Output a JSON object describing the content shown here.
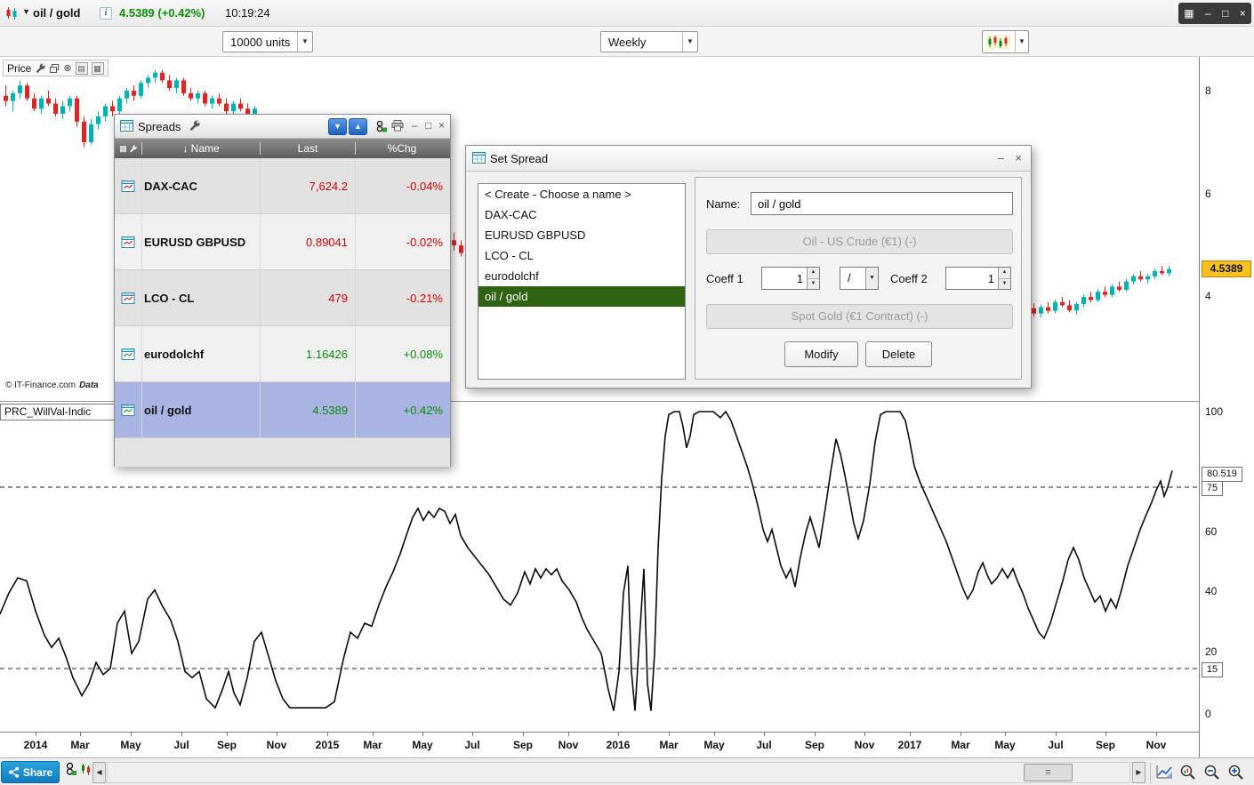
{
  "titlebar": {
    "symbol": "oil / gold",
    "quote": "4.5389 (+0.42%)",
    "time": "10:19:24",
    "info": "i"
  },
  "toolbar": {
    "units_value": "10000 units",
    "period_value": "Weekly"
  },
  "price_panel": {
    "label": "Price",
    "copyright": "© IT-Finance.com",
    "copyright_suffix": "Data"
  },
  "indicator_label": "PRC_WillVal-Indic",
  "axes": {
    "price_ticks": [
      "8",
      "6",
      "4"
    ],
    "price_badge": "4.5389",
    "ind_ticks": [
      "100",
      "60",
      "40",
      "20",
      "0"
    ],
    "ind_badge": "80.519",
    "ind_level_hi": "75",
    "ind_level_lo": "15"
  },
  "spreads_window": {
    "title": "Spreads",
    "header": {
      "name": "Name",
      "last": "Last",
      "chg": "%Chg"
    },
    "rows": [
      {
        "name": "DAX-CAC",
        "last": "7,624.2",
        "chg": "-0.04%",
        "dir": "down",
        "selected": false
      },
      {
        "name": "EURUSD GBPUSD",
        "last": "0.89041",
        "chg": "-0.02%",
        "dir": "down",
        "selected": false
      },
      {
        "name": "LCO - CL",
        "last": "479",
        "chg": "-0.21%",
        "dir": "down",
        "selected": false
      },
      {
        "name": "eurodolchf",
        "last": "1.16426",
        "chg": "+0.08%",
        "dir": "up",
        "selected": false
      },
      {
        "name": "oil / gold",
        "last": "4.5389",
        "chg": "+0.42%",
        "dir": "up",
        "selected": true
      }
    ]
  },
  "set_spread": {
    "title": "Set Spread",
    "list": [
      "< Create - Choose a name >",
      "DAX-CAC",
      "EURUSD GBPUSD",
      "LCO - CL",
      "eurodolchf",
      "oil / gold"
    ],
    "selected_index": 5,
    "name_label": "Name:",
    "name_value": "oil / gold",
    "instrument1": "Oil - US Crude (€1) (-)",
    "coeff1_label": "Coeff 1",
    "coeff1_value": "1",
    "operator": "/",
    "coeff2_label": "Coeff 2",
    "coeff2_value": "1",
    "instrument2": "Spot Gold (€1 Contract) (-)",
    "modify_label": "Modify",
    "delete_label": "Delete"
  },
  "bottom_bar": {
    "share_label": "Share",
    "thumb_grip": "≡"
  },
  "colors": {
    "candle_up": "#00b3b3",
    "candle_down": "#dd2626",
    "positive": "#0a8a0a",
    "negative": "#d40000",
    "selected_row": "#a9b4e2",
    "selected_list_item": "#2e6311",
    "price_badge_bg": "#f7c11e",
    "accent_blue": "#1d64c0"
  },
  "chart_data": {
    "type": "candlestick+line",
    "period": "Weekly",
    "price_panel": {
      "yticks": [
        8,
        6,
        4
      ],
      "last": 4.5389,
      "candles": [
        [
          4,
          7.9,
          8.1,
          7.7,
          7.8
        ],
        [
          12,
          7.8,
          8.0,
          7.6,
          7.95
        ],
        [
          20,
          7.95,
          8.2,
          7.85,
          8.1
        ],
        [
          28,
          8.1,
          8.15,
          7.8,
          7.85
        ],
        [
          36,
          7.85,
          7.95,
          7.6,
          7.65
        ],
        [
          44,
          7.65,
          7.9,
          7.55,
          7.85
        ],
        [
          52,
          7.85,
          8.0,
          7.7,
          7.75
        ],
        [
          60,
          7.75,
          7.85,
          7.5,
          7.55
        ],
        [
          68,
          7.55,
          7.8,
          7.45,
          7.7
        ],
        [
          76,
          7.7,
          7.9,
          7.6,
          7.85
        ],
        [
          84,
          7.85,
          7.9,
          7.3,
          7.4
        ],
        [
          92,
          7.4,
          7.5,
          6.9,
          7.0
        ],
        [
          100,
          7.0,
          7.45,
          6.95,
          7.35
        ],
        [
          108,
          7.35,
          7.6,
          7.25,
          7.5
        ],
        [
          116,
          7.5,
          7.75,
          7.4,
          7.7
        ],
        [
          124,
          7.7,
          7.8,
          7.5,
          7.6
        ],
        [
          132,
          7.6,
          7.9,
          7.55,
          7.85
        ],
        [
          140,
          7.85,
          8.05,
          7.75,
          8.0
        ],
        [
          148,
          8.0,
          8.1,
          7.8,
          7.9
        ],
        [
          156,
          7.9,
          8.2,
          7.85,
          8.15
        ],
        [
          164,
          8.15,
          8.3,
          8.05,
          8.25
        ],
        [
          172,
          8.25,
          8.4,
          8.15,
          8.35
        ],
        [
          180,
          8.35,
          8.4,
          8.15,
          8.2
        ],
        [
          188,
          8.2,
          8.3,
          8.0,
          8.05
        ],
        [
          196,
          8.05,
          8.25,
          7.95,
          8.2
        ],
        [
          204,
          8.2,
          8.25,
          7.9,
          7.95
        ],
        [
          212,
          7.95,
          8.05,
          7.8,
          7.85
        ],
        [
          220,
          7.85,
          8.0,
          7.75,
          7.95
        ],
        [
          228,
          7.95,
          8.0,
          7.7,
          7.75
        ],
        [
          236,
          7.75,
          7.9,
          7.65,
          7.85
        ],
        [
          244,
          7.85,
          7.95,
          7.7,
          7.75
        ],
        [
          252,
          7.75,
          7.85,
          7.55,
          7.6
        ],
        [
          260,
          7.6,
          7.8,
          7.5,
          7.75
        ],
        [
          268,
          7.75,
          7.85,
          7.6,
          7.65
        ],
        [
          276,
          7.65,
          7.75,
          7.5,
          7.55
        ],
        [
          284,
          7.55,
          7.7,
          7.45,
          7.65
        ],
        [
          508,
          5.1,
          5.25,
          4.9,
          5.0
        ],
        [
          516,
          5.0,
          5.1,
          4.78,
          4.85
        ],
        [
          1152,
          3.85,
          3.95,
          3.72,
          3.78
        ],
        [
          1160,
          3.78,
          3.88,
          3.62,
          3.68
        ],
        [
          1168,
          3.68,
          3.85,
          3.6,
          3.8
        ],
        [
          1176,
          3.8,
          3.9,
          3.68,
          3.73
        ],
        [
          1184,
          3.73,
          3.95,
          3.68,
          3.9
        ],
        [
          1192,
          3.9,
          4.0,
          3.8,
          3.84
        ],
        [
          1200,
          3.84,
          3.94,
          3.7,
          3.74
        ],
        [
          1208,
          3.74,
          3.9,
          3.66,
          3.86
        ],
        [
          1216,
          3.86,
          4.05,
          3.8,
          4.0
        ],
        [
          1224,
          4.0,
          4.1,
          3.9,
          3.94
        ],
        [
          1232,
          3.94,
          4.15,
          3.9,
          4.1
        ],
        [
          1240,
          4.1,
          4.2,
          4.0,
          4.04
        ],
        [
          1248,
          4.04,
          4.25,
          4.0,
          4.2
        ],
        [
          1256,
          4.2,
          4.3,
          4.1,
          4.14
        ],
        [
          1264,
          4.14,
          4.35,
          4.1,
          4.3
        ],
        [
          1272,
          4.3,
          4.44,
          4.24,
          4.4
        ],
        [
          1280,
          4.4,
          4.5,
          4.3,
          4.34
        ],
        [
          1288,
          4.34,
          4.45,
          4.26,
          4.4
        ],
        [
          1296,
          4.4,
          4.55,
          4.34,
          4.5
        ],
        [
          1304,
          4.5,
          4.6,
          4.42,
          4.46
        ],
        [
          1312,
          4.46,
          4.6,
          4.4,
          4.54
        ]
      ]
    },
    "indicator": {
      "name": "PRC_WillVal-Indic",
      "yticks": [
        100,
        75,
        60,
        40,
        20,
        15,
        0
      ],
      "levels": [
        75,
        15
      ],
      "last": 80.519,
      "points": [
        [
          0,
          33
        ],
        [
          10,
          40
        ],
        [
          20,
          45
        ],
        [
          30,
          44
        ],
        [
          40,
          34
        ],
        [
          50,
          26
        ],
        [
          58,
          22
        ],
        [
          66,
          25
        ],
        [
          74,
          19
        ],
        [
          82,
          12
        ],
        [
          92,
          6
        ],
        [
          100,
          10
        ],
        [
          108,
          17
        ],
        [
          116,
          13
        ],
        [
          124,
          15
        ],
        [
          132,
          30
        ],
        [
          140,
          34
        ],
        [
          148,
          20
        ],
        [
          156,
          24
        ],
        [
          166,
          38
        ],
        [
          174,
          41
        ],
        [
          182,
          36
        ],
        [
          192,
          31
        ],
        [
          200,
          24
        ],
        [
          208,
          14
        ],
        [
          216,
          12
        ],
        [
          224,
          14
        ],
        [
          232,
          5
        ],
        [
          242,
          2
        ],
        [
          250,
          8
        ],
        [
          257,
          14
        ],
        [
          263,
          7
        ],
        [
          270,
          3
        ],
        [
          278,
          12
        ],
        [
          286,
          24
        ],
        [
          294,
          27
        ],
        [
          302,
          19
        ],
        [
          310,
          11
        ],
        [
          318,
          5
        ],
        [
          326,
          2
        ],
        [
          340,
          2
        ],
        [
          354,
          2
        ],
        [
          366,
          2
        ],
        [
          376,
          4
        ],
        [
          386,
          18
        ],
        [
          394,
          27
        ],
        [
          402,
          25
        ],
        [
          410,
          30
        ],
        [
          418,
          29
        ],
        [
          426,
          36
        ],
        [
          434,
          42
        ],
        [
          442,
          47
        ],
        [
          450,
          53
        ],
        [
          458,
          60
        ],
        [
          464,
          65
        ],
        [
          470,
          68
        ],
        [
          476,
          64
        ],
        [
          482,
          67
        ],
        [
          488,
          65
        ],
        [
          494,
          68
        ],
        [
          500,
          67
        ],
        [
          506,
          63
        ],
        [
          512,
          66
        ],
        [
          518,
          59
        ],
        [
          526,
          55
        ],
        [
          534,
          52
        ],
        [
          542,
          49
        ],
        [
          550,
          46
        ],
        [
          558,
          42
        ],
        [
          566,
          38
        ],
        [
          574,
          36
        ],
        [
          582,
          40
        ],
        [
          590,
          47
        ],
        [
          596,
          43
        ],
        [
          602,
          48
        ],
        [
          608,
          45
        ],
        [
          614,
          48
        ],
        [
          620,
          46
        ],
        [
          626,
          48
        ],
        [
          632,
          44
        ],
        [
          640,
          41
        ],
        [
          648,
          37
        ],
        [
          654,
          32
        ],
        [
          660,
          28
        ],
        [
          668,
          24
        ],
        [
          676,
          20
        ],
        [
          684,
          8
        ],
        [
          690,
          1
        ],
        [
          696,
          14
        ],
        [
          701,
          40
        ],
        [
          706,
          49
        ],
        [
          710,
          14
        ],
        [
          714,
          1
        ],
        [
          719,
          25
        ],
        [
          724,
          48
        ],
        [
          728,
          10
        ],
        [
          732,
          1
        ],
        [
          736,
          20
        ],
        [
          740,
          55
        ],
        [
          744,
          78
        ],
        [
          748,
          92
        ],
        [
          752,
          99
        ],
        [
          758,
          100
        ],
        [
          764,
          100
        ],
        [
          768,
          95
        ],
        [
          772,
          88
        ],
        [
          776,
          92
        ],
        [
          780,
          99
        ],
        [
          786,
          100
        ],
        [
          794,
          100
        ],
        [
          802,
          100
        ],
        [
          810,
          98
        ],
        [
          816,
          100
        ],
        [
          822,
          97
        ],
        [
          828,
          92
        ],
        [
          834,
          87
        ],
        [
          840,
          82
        ],
        [
          846,
          76
        ],
        [
          852,
          69
        ],
        [
          858,
          61
        ],
        [
          863,
          57
        ],
        [
          868,
          61
        ],
        [
          873,
          55
        ],
        [
          878,
          49
        ],
        [
          884,
          45
        ],
        [
          889,
          48
        ],
        [
          894,
          42
        ],
        [
          900,
          52
        ],
        [
          906,
          60
        ],
        [
          911,
          65
        ],
        [
          916,
          60
        ],
        [
          921,
          55
        ],
        [
          928,
          68
        ],
        [
          934,
          80
        ],
        [
          940,
          91
        ],
        [
          945,
          86
        ],
        [
          950,
          79
        ],
        [
          955,
          71
        ],
        [
          960,
          63
        ],
        [
          965,
          58
        ],
        [
          971,
          64
        ],
        [
          978,
          76
        ],
        [
          984,
          90
        ],
        [
          990,
          99
        ],
        [
          996,
          100
        ],
        [
          1004,
          100
        ],
        [
          1012,
          100
        ],
        [
          1018,
          97
        ],
        [
          1023,
          90
        ],
        [
          1028,
          82
        ],
        [
          1034,
          77
        ],
        [
          1040,
          73
        ],
        [
          1046,
          69
        ],
        [
          1052,
          65
        ],
        [
          1058,
          61
        ],
        [
          1064,
          57
        ],
        [
          1070,
          52
        ],
        [
          1076,
          47
        ],
        [
          1082,
          42
        ],
        [
          1088,
          38
        ],
        [
          1094,
          41
        ],
        [
          1100,
          47
        ],
        [
          1105,
          50
        ],
        [
          1110,
          46
        ],
        [
          1115,
          43
        ],
        [
          1121,
          45
        ],
        [
          1127,
          48
        ],
        [
          1133,
          45
        ],
        [
          1139,
          48
        ],
        [
          1144,
          44
        ],
        [
          1150,
          40
        ],
        [
          1156,
          35
        ],
        [
          1162,
          31
        ],
        [
          1168,
          27
        ],
        [
          1174,
          25
        ],
        [
          1181,
          30
        ],
        [
          1188,
          37
        ],
        [
          1195,
          44
        ],
        [
          1201,
          51
        ],
        [
          1207,
          55
        ],
        [
          1213,
          51
        ],
        [
          1219,
          45
        ],
        [
          1225,
          41
        ],
        [
          1231,
          37
        ],
        [
          1237,
          39
        ],
        [
          1243,
          34
        ],
        [
          1249,
          38
        ],
        [
          1255,
          35
        ],
        [
          1261,
          41
        ],
        [
          1268,
          49
        ],
        [
          1275,
          55
        ],
        [
          1282,
          61
        ],
        [
          1289,
          66
        ],
        [
          1295,
          70
        ],
        [
          1300,
          74
        ],
        [
          1305,
          77
        ],
        [
          1309,
          72
        ],
        [
          1313,
          75
        ],
        [
          1318,
          80.5
        ]
      ]
    },
    "x_labels": [
      [
        "2014",
        40
      ],
      [
        "Mar",
        90
      ],
      [
        "May",
        147
      ],
      [
        "Jul",
        204
      ],
      [
        "Sep",
        255
      ],
      [
        "Nov",
        311
      ],
      [
        "2015",
        368
      ],
      [
        "Mar",
        419
      ],
      [
        "May",
        475
      ],
      [
        "Jul",
        531
      ],
      [
        "Sep",
        588
      ],
      [
        "Nov",
        639
      ],
      [
        "2016",
        695
      ],
      [
        "Mar",
        752
      ],
      [
        "May",
        803
      ],
      [
        "Jul",
        859
      ],
      [
        "Sep",
        916
      ],
      [
        "Nov",
        972
      ],
      [
        "2017",
        1023
      ],
      [
        "Mar",
        1080
      ],
      [
        "May",
        1130
      ],
      [
        "Jul",
        1187
      ],
      [
        "Sep",
        1243
      ],
      [
        "Nov",
        1300
      ]
    ]
  }
}
